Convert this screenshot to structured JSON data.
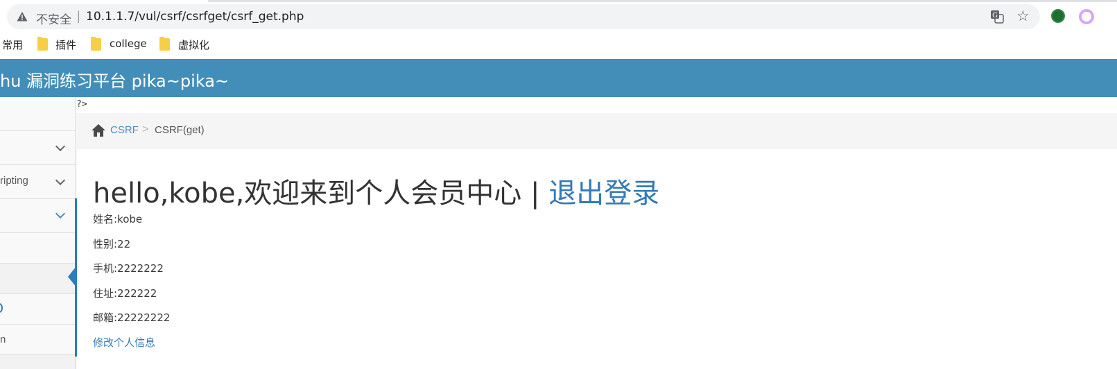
{
  "browser": {
    "security_label": "不安全",
    "url_separator": "|",
    "url": "10.1.1.7/vul/csrf/csrfget/csrf_get.php",
    "bookmarks": [
      {
        "label": "常用",
        "folder": false
      },
      {
        "label": "插件",
        "folder": true
      },
      {
        "label": "college",
        "folder": true
      },
      {
        "label": "虚拟化",
        "folder": true
      }
    ]
  },
  "header": {
    "title": "hu 漏洞练习平台 pika~pika~"
  },
  "sidebar": {
    "items": [
      {
        "label": ""
      },
      {
        "label": ""
      },
      {
        "label": "ripting"
      },
      {
        "label": ""
      },
      {
        "label": ""
      },
      {
        "label": ""
      },
      {
        "label": ""
      },
      {
        "label": "n"
      }
    ]
  },
  "page": {
    "php_artifact": "?>",
    "breadcrumb": {
      "section": "CSRF",
      "separator": ">",
      "current": "CSRF(get)"
    },
    "welcome_text": "hello,kobe,欢迎来到个人会员中心 | ",
    "logout_label": "退出登录",
    "info": [
      "姓名:kobe",
      "性别:22",
      "手机:2222222",
      "住址:222222",
      "邮箱:22222222"
    ],
    "edit_link": "修改个人信息"
  },
  "colors": {
    "header_bg": "#438eb9",
    "link": "#337ab7",
    "sidebar_active": "#2b7dbc"
  }
}
